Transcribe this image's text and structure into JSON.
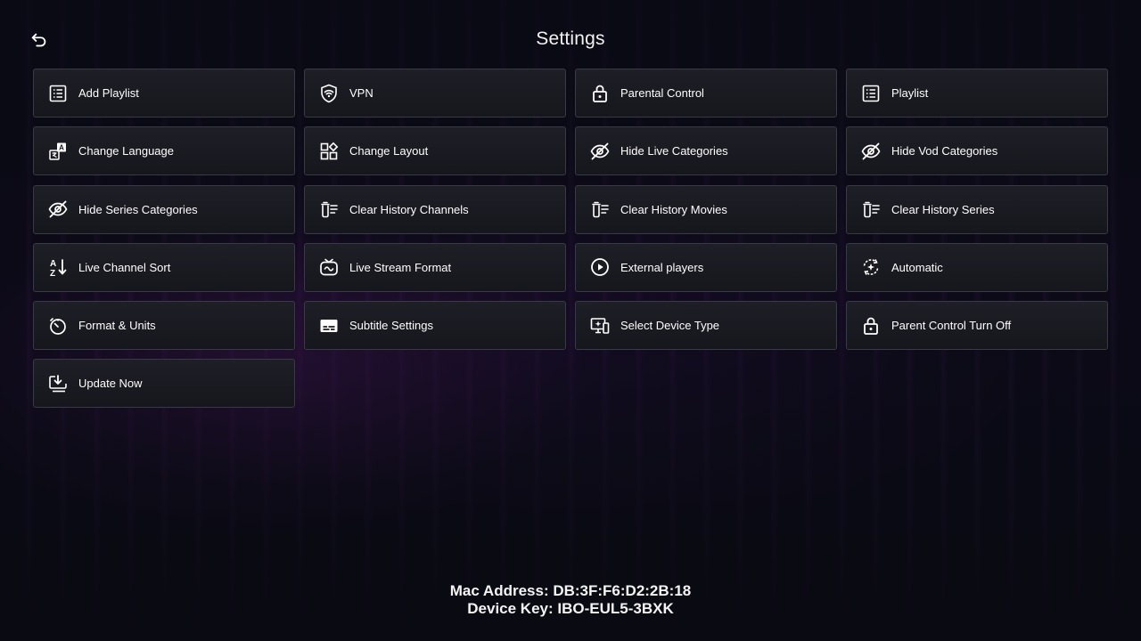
{
  "header": {
    "title": "Settings",
    "back_icon": "back-arrow-icon"
  },
  "tiles": [
    {
      "label": "Add Playlist",
      "icon": "playlist-add-icon"
    },
    {
      "label": "VPN",
      "icon": "vpn-shield-icon"
    },
    {
      "label": "Parental Control",
      "icon": "lock-icon"
    },
    {
      "label": "Playlist",
      "icon": "playlist-icon"
    },
    {
      "label": "Change Language",
      "icon": "language-icon"
    },
    {
      "label": "Change Layout",
      "icon": "layout-icon"
    },
    {
      "label": "Hide Live Categories",
      "icon": "eye-off-icon"
    },
    {
      "label": "Hide Vod Categories",
      "icon": "eye-off-icon"
    },
    {
      "label": "Hide Series Categories",
      "icon": "eye-off-icon"
    },
    {
      "label": "Clear History Channels",
      "icon": "clear-history-icon"
    },
    {
      "label": "Clear History Movies",
      "icon": "clear-history-icon"
    },
    {
      "label": "Clear History Series",
      "icon": "clear-history-icon"
    },
    {
      "label": "Live Channel Sort",
      "icon": "sort-az-icon"
    },
    {
      "label": "Live Stream Format",
      "icon": "tv-icon"
    },
    {
      "label": "External players",
      "icon": "play-circle-icon"
    },
    {
      "label": "Automatic",
      "icon": "auto-refresh-icon"
    },
    {
      "label": "Format & Units",
      "icon": "timer-icon"
    },
    {
      "label": "Subtitle Settings",
      "icon": "subtitles-icon"
    },
    {
      "label": "Select Device Type",
      "icon": "device-icon"
    },
    {
      "label": "Parent Control Turn Off",
      "icon": "lock-icon"
    },
    {
      "label": "Update Now",
      "icon": "download-screen-icon"
    }
  ],
  "footer": {
    "mac_address": "Mac Address: DB:3F:F6:D2:2B:18",
    "device_key": "Device Key: IBO-EUL5-3BXK"
  },
  "colors": {
    "background": "#0b0b16",
    "tile_background": "#1a1a22",
    "tile_border": "#3a3a46",
    "text": "#ffffff",
    "accent_glow": "#6e1e82"
  }
}
